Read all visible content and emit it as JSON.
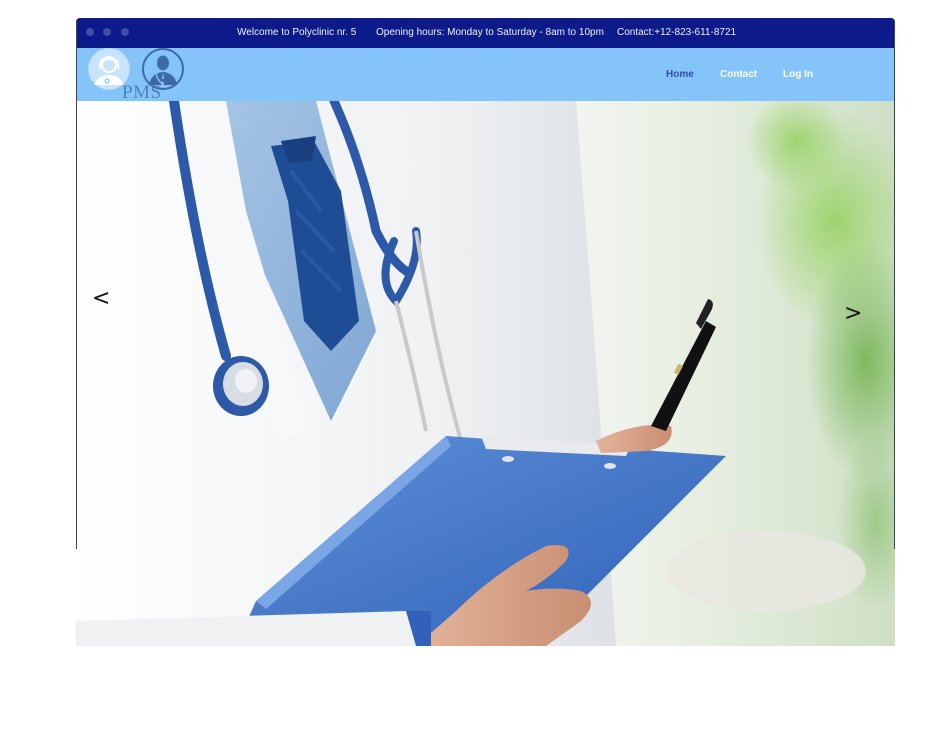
{
  "topbar": {
    "welcome": "Welcome to Polyclinic nr. 5",
    "hours": "Opening hours: Monday to Saturday - 8am to 10pm",
    "contact": "Contact:+12-823-611-8721"
  },
  "logo": {
    "text": "PMS",
    "icons": [
      "female-doctor-icon",
      "male-doctor-icon"
    ]
  },
  "nav": {
    "items": [
      {
        "label": "Home",
        "active": true
      },
      {
        "label": "Contact",
        "active": false
      },
      {
        "label": "Log In",
        "active": false
      }
    ]
  },
  "carousel": {
    "prev_label": "<",
    "next_label": ">",
    "image": "doctor-with-clipboard-photo"
  },
  "colors": {
    "topbar": "#0d1b8a",
    "navbar": "#84c4f9",
    "nav_active": "#2f4fb0",
    "nav_text": "#ffffff"
  }
}
